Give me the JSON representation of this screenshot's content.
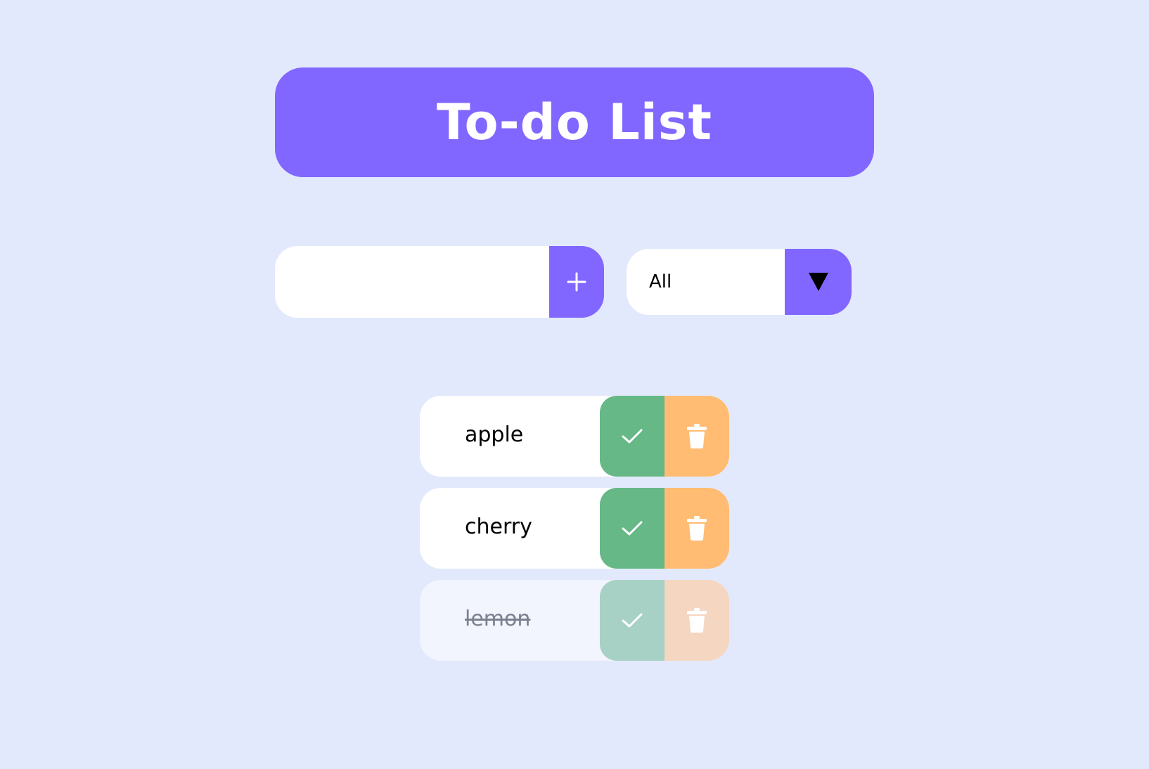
{
  "header": {
    "title": "To-do List"
  },
  "add_form": {
    "input_value": "",
    "add_icon": "plus-icon"
  },
  "filter": {
    "selected": "All",
    "caret_icon": "caret-down-icon"
  },
  "todos": [
    {
      "text": "apple",
      "completed": false
    },
    {
      "text": "cherry",
      "completed": false
    },
    {
      "text": "lemon",
      "completed": true
    }
  ],
  "colors": {
    "background": "#e3e9fc",
    "accent": "#8167ff",
    "check": "#66b886",
    "trash": "#ffbc72",
    "check_completed": "#a7d1c4",
    "trash_completed": "#f5d6c1",
    "completed_row": "#f2f4fe"
  }
}
